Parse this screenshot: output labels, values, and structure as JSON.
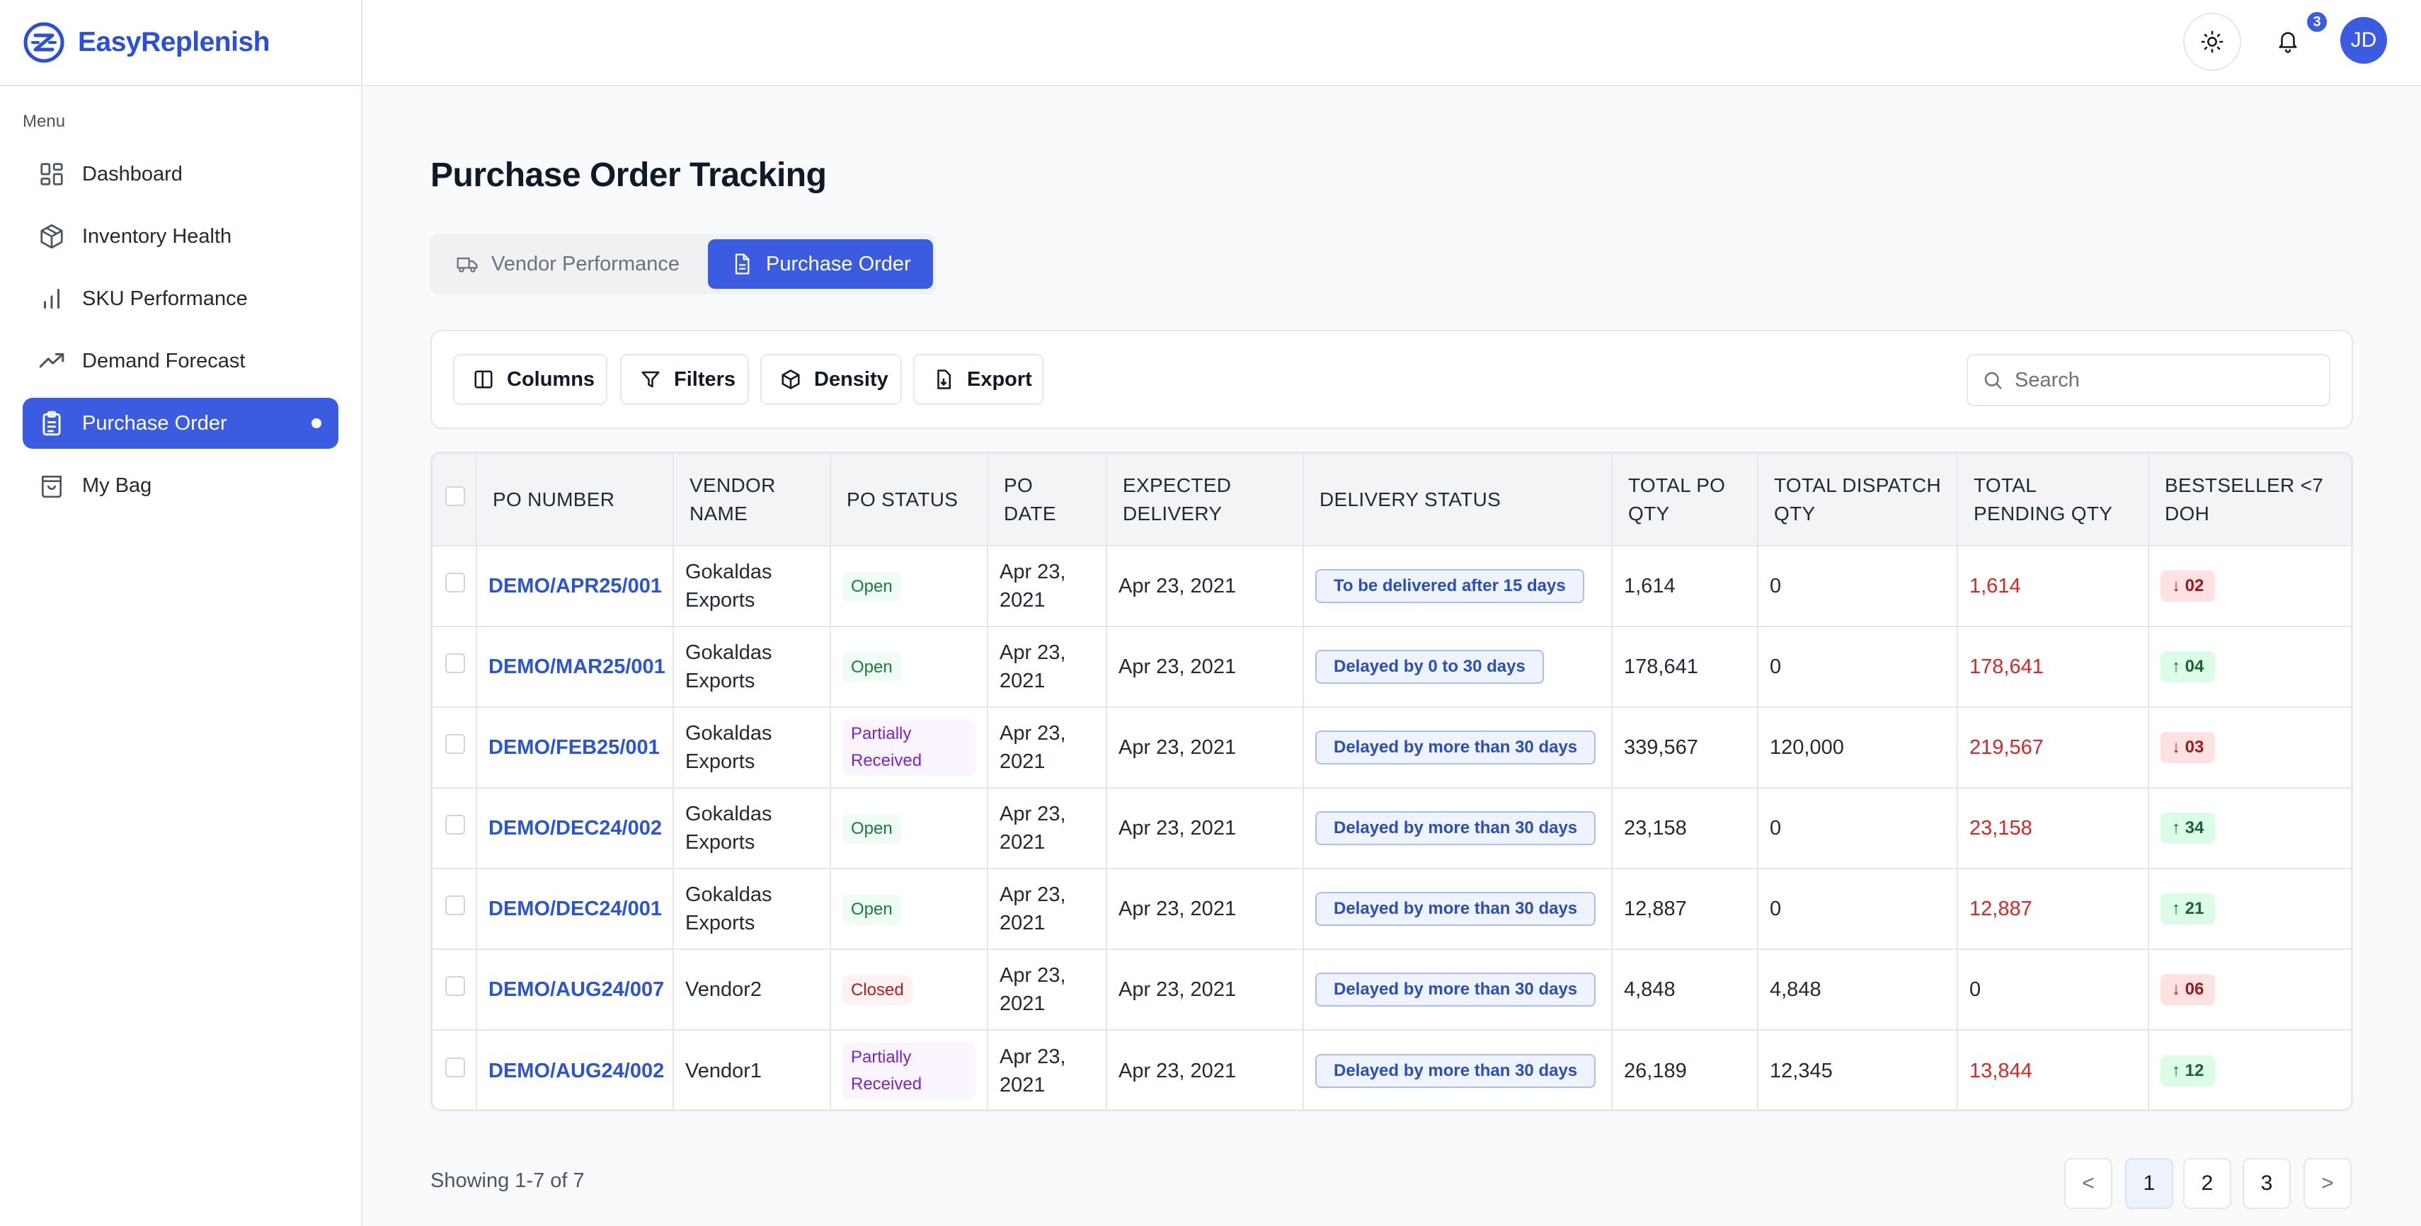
{
  "brand": {
    "name": "EasyReplenish",
    "color": "#2b4fd8"
  },
  "sidebar": {
    "menu_label": "Menu",
    "items": [
      {
        "label": "Dashboard",
        "icon": "dashboard-grid-icon",
        "active": false
      },
      {
        "label": "Inventory Health",
        "icon": "box-icon",
        "active": false
      },
      {
        "label": "SKU Performance",
        "icon": "bar-chart-icon",
        "active": false
      },
      {
        "label": "Demand Forecast",
        "icon": "trending-up-icon",
        "active": false
      },
      {
        "label": "Purchase Order",
        "icon": "clipboard-icon",
        "active": true
      },
      {
        "label": "My Bag",
        "icon": "shopping-bag-icon",
        "active": false
      }
    ]
  },
  "topbar": {
    "notification_count": "3",
    "avatar_initials": "JD"
  },
  "page": {
    "title": "Purchase Order Tracking"
  },
  "tabs": [
    {
      "label": "Vendor Performance",
      "icon": "truck-icon",
      "active": false
    },
    {
      "label": "Purchase Order",
      "icon": "document-icon",
      "active": true
    }
  ],
  "toolbar": {
    "columns_label": "Columns",
    "filters_label": "Filters",
    "density_label": "Density",
    "export_label": "Export",
    "search_placeholder": "Search"
  },
  "table": {
    "headers": {
      "po_number": "PO NUMBER",
      "vendor_name": "VENDOR NAME",
      "po_status": "PO STATUS",
      "po_date": "PO DATE",
      "expected_delivery": "EXPECTED DELIVERY",
      "delivery_status": "DELIVERY STATUS",
      "total_po_qty": "TOTAL PO QTY",
      "total_dispatch_qty": "TOTAL DISPATCH QTY",
      "total_pending_qty": "TOTAL PENDING QTY",
      "bestseller": "BESTSELLER <7 DOH"
    },
    "rows": [
      {
        "po_number": "DEMO/APR25/001",
        "vendor_name": "Gokaldas Exports",
        "po_status": "Open",
        "po_date": "Apr 23, 2021",
        "expected_delivery": "Apr 23, 2021",
        "delivery_status": "To be delivered after 15 days",
        "total_po_qty": "1,614",
        "total_dispatch_qty": "0",
        "total_pending_qty": "1,614",
        "bestseller": "↓ 02",
        "trend": "down"
      },
      {
        "po_number": "DEMO/MAR25/001",
        "vendor_name": "Gokaldas Exports",
        "po_status": "Open",
        "po_date": "Apr 23, 2021",
        "expected_delivery": "Apr 23, 2021",
        "delivery_status": "Delayed by 0 to 30 days",
        "total_po_qty": "178,641",
        "total_dispatch_qty": "0",
        "total_pending_qty": "178,641",
        "bestseller": "↑ 04",
        "trend": "up"
      },
      {
        "po_number": "DEMO/FEB25/001",
        "vendor_name": "Gokaldas Exports",
        "po_status": "Partially Received",
        "po_date": "Apr 23, 2021",
        "expected_delivery": "Apr 23, 2021",
        "delivery_status": "Delayed by more than 30 days",
        "total_po_qty": "339,567",
        "total_dispatch_qty": "120,000",
        "total_pending_qty": "219,567",
        "bestseller": "↓ 03",
        "trend": "down"
      },
      {
        "po_number": "DEMO/DEC24/002",
        "vendor_name": "Gokaldas Exports",
        "po_status": "Open",
        "po_date": "Apr 23, 2021",
        "expected_delivery": "Apr 23, 2021",
        "delivery_status": "Delayed by more than 30 days",
        "total_po_qty": "23,158",
        "total_dispatch_qty": "0",
        "total_pending_qty": "23,158",
        "bestseller": "↑ 34",
        "trend": "up"
      },
      {
        "po_number": "DEMO/DEC24/001",
        "vendor_name": "Gokaldas Exports",
        "po_status": "Open",
        "po_date": "Apr 23, 2021",
        "expected_delivery": "Apr 23, 2021",
        "delivery_status": "Delayed by more than 30 days",
        "total_po_qty": "12,887",
        "total_dispatch_qty": "0",
        "total_pending_qty": "12,887",
        "bestseller": "↑ 21",
        "trend": "up"
      },
      {
        "po_number": "DEMO/AUG24/007",
        "vendor_name": "Vendor2",
        "po_status": "Closed",
        "po_date": "Apr 23, 2021",
        "expected_delivery": "Apr 23, 2021",
        "delivery_status": "Delayed by more than 30 days",
        "total_po_qty": "4,848",
        "total_dispatch_qty": "4,848",
        "total_pending_qty": "0",
        "bestseller": "↓ 06",
        "trend": "down"
      },
      {
        "po_number": "DEMO/AUG24/002",
        "vendor_name": "Vendor1",
        "po_status": "Partially Received",
        "po_date": "Apr 23, 2021",
        "expected_delivery": "Apr 23, 2021",
        "delivery_status": "Delayed by more than 30 days",
        "total_po_qty": "26,189",
        "total_dispatch_qty": "12,345",
        "total_pending_qty": "13,844",
        "bestseller": "↑ 12",
        "trend": "up"
      }
    ]
  },
  "pagination": {
    "showing": "Showing 1-7 of 7",
    "prev": "<",
    "next": ">",
    "pages": [
      "1",
      "2",
      "3"
    ],
    "current": "1"
  },
  "colors": {
    "accent": "#3b5ce0",
    "link": "#2b55d6",
    "pending": "#dc2626"
  }
}
